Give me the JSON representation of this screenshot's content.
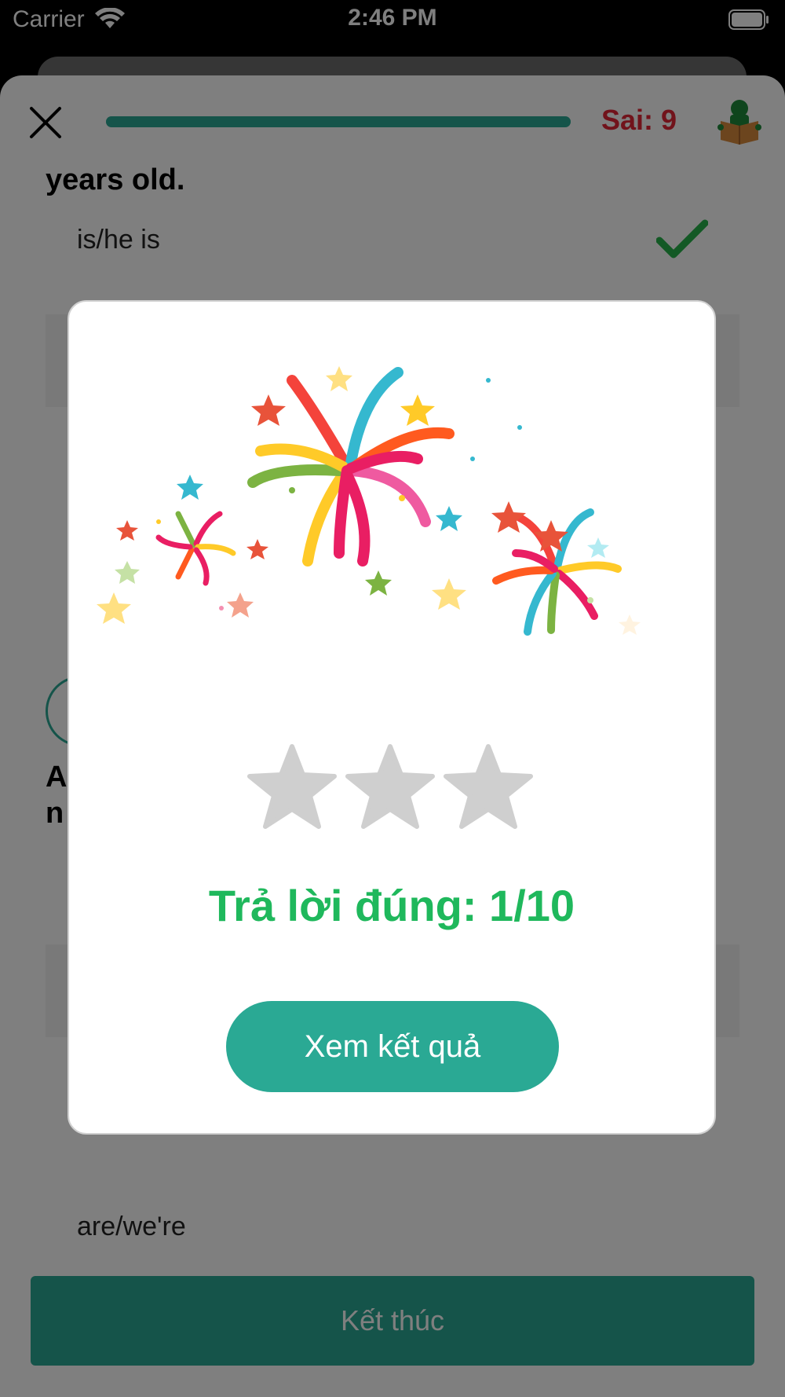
{
  "status_bar": {
    "carrier": "Carrier",
    "time": "2:46 PM"
  },
  "quiz": {
    "progress_fraction": 1.0,
    "wrong_label": "Sai: 9",
    "question_fragment": "years old.",
    "answers": [
      {
        "label": "is/he is",
        "correct": true
      },
      {
        "label": ""
      },
      {
        "label": ""
      },
      {
        "label": "are/we're"
      }
    ],
    "question2_fragment_line1": "A",
    "question2_fragment_line2": "n",
    "finish_label": "Kết thúc"
  },
  "modal": {
    "stars_earned": 0,
    "stars_total": 3,
    "result_text": "Trả lời đúng: 1/10",
    "view_result_label": "Xem kết quả"
  },
  "colors": {
    "accent": "#2aa994",
    "wrong_red": "#e32636",
    "success_green": "#1fb85c",
    "star_empty": "#cfcfcf"
  },
  "icons": {
    "close": "close-icon",
    "book": "book-reader-icon",
    "check": "checkmark-icon",
    "wifi": "wifi-icon",
    "battery": "battery-icon",
    "star": "star-icon"
  }
}
